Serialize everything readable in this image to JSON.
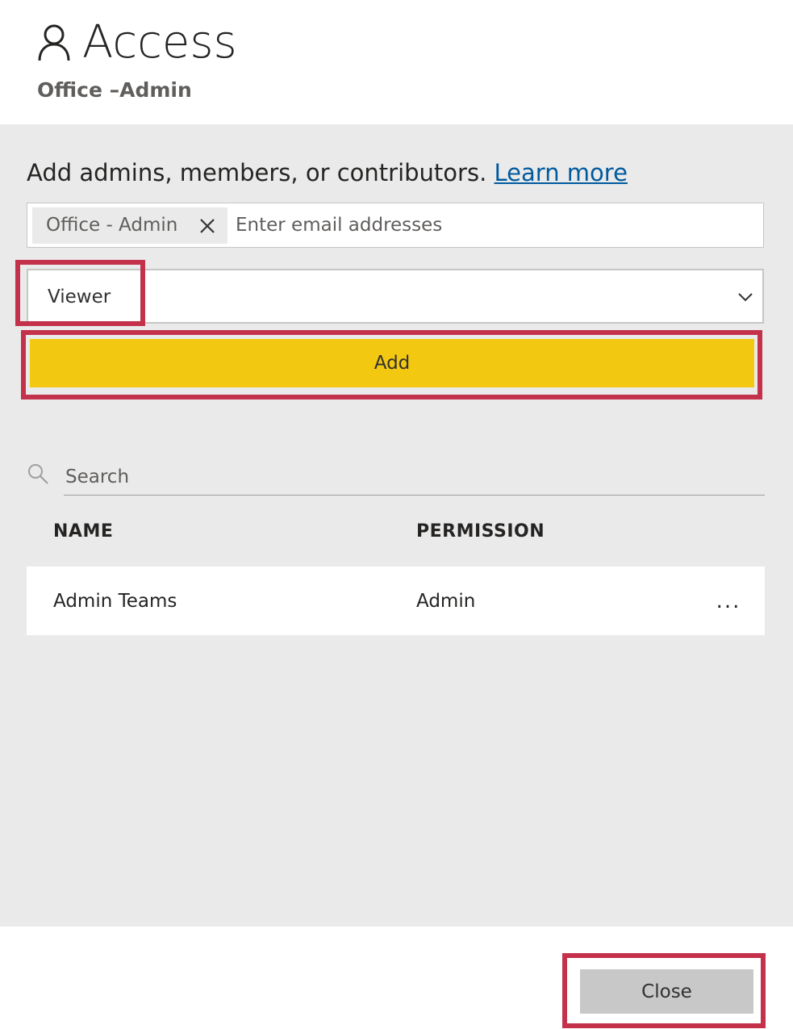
{
  "header": {
    "title": "Access",
    "subtitle": "Office –Admin"
  },
  "intro": {
    "text": "Add admins, members, or contributors. ",
    "link": "Learn more"
  },
  "email": {
    "chip_label": "Office - Admin",
    "placeholder": "Enter email addresses",
    "value": ""
  },
  "role_select": {
    "value": "Viewer"
  },
  "add_button": {
    "label": "Add"
  },
  "search": {
    "placeholder": "Search"
  },
  "table": {
    "headers": [
      "NAME",
      "PERMISSION"
    ],
    "rows": [
      {
        "name": "Admin Teams",
        "permission": "Admin",
        "more": "..."
      }
    ]
  },
  "footer": {
    "close_label": "Close"
  },
  "colors": {
    "accent": "#f2c811",
    "highlight": "#c4314b",
    "link": "#005a9e",
    "panel": "#eaeaea"
  }
}
